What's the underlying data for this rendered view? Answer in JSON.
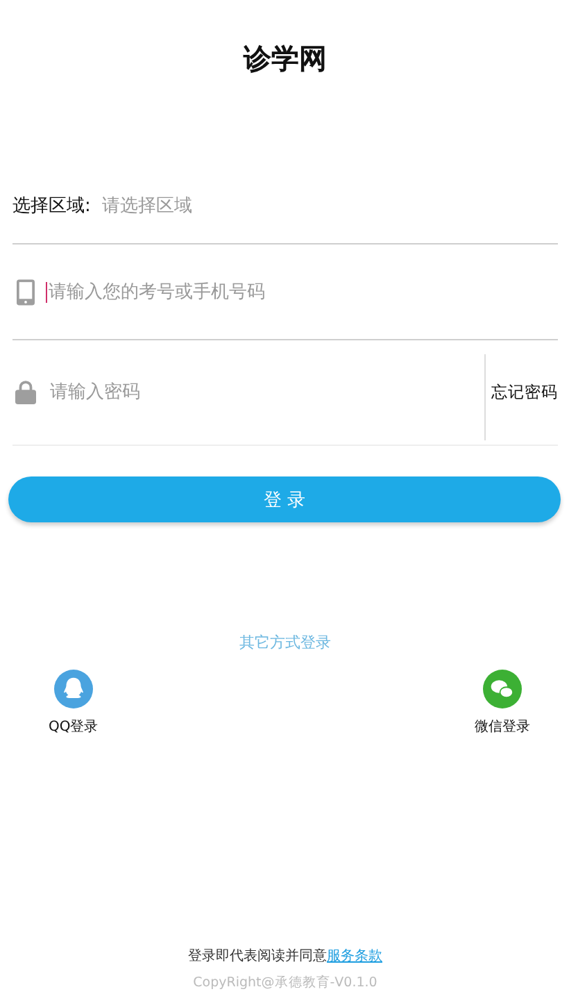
{
  "title": "诊学网",
  "region": {
    "label": "选择区域:",
    "placeholder": "请选择区域"
  },
  "account": {
    "placeholder": "请输入您的考号或手机号码",
    "focused": true
  },
  "password": {
    "placeholder": "请输入密码",
    "forgot": "忘记密码"
  },
  "login_button": "登 录",
  "other_login": {
    "heading": "其它方式登录",
    "options": [
      {
        "kind": "qq",
        "label": "QQ登录"
      },
      {
        "kind": "wechat",
        "label": "微信登录"
      }
    ]
  },
  "footer": {
    "agreement": "登录即代表阅读并同意",
    "terms_link": "服务条款",
    "copyright": "CopyRight@承德教育-V0.1.0"
  }
}
